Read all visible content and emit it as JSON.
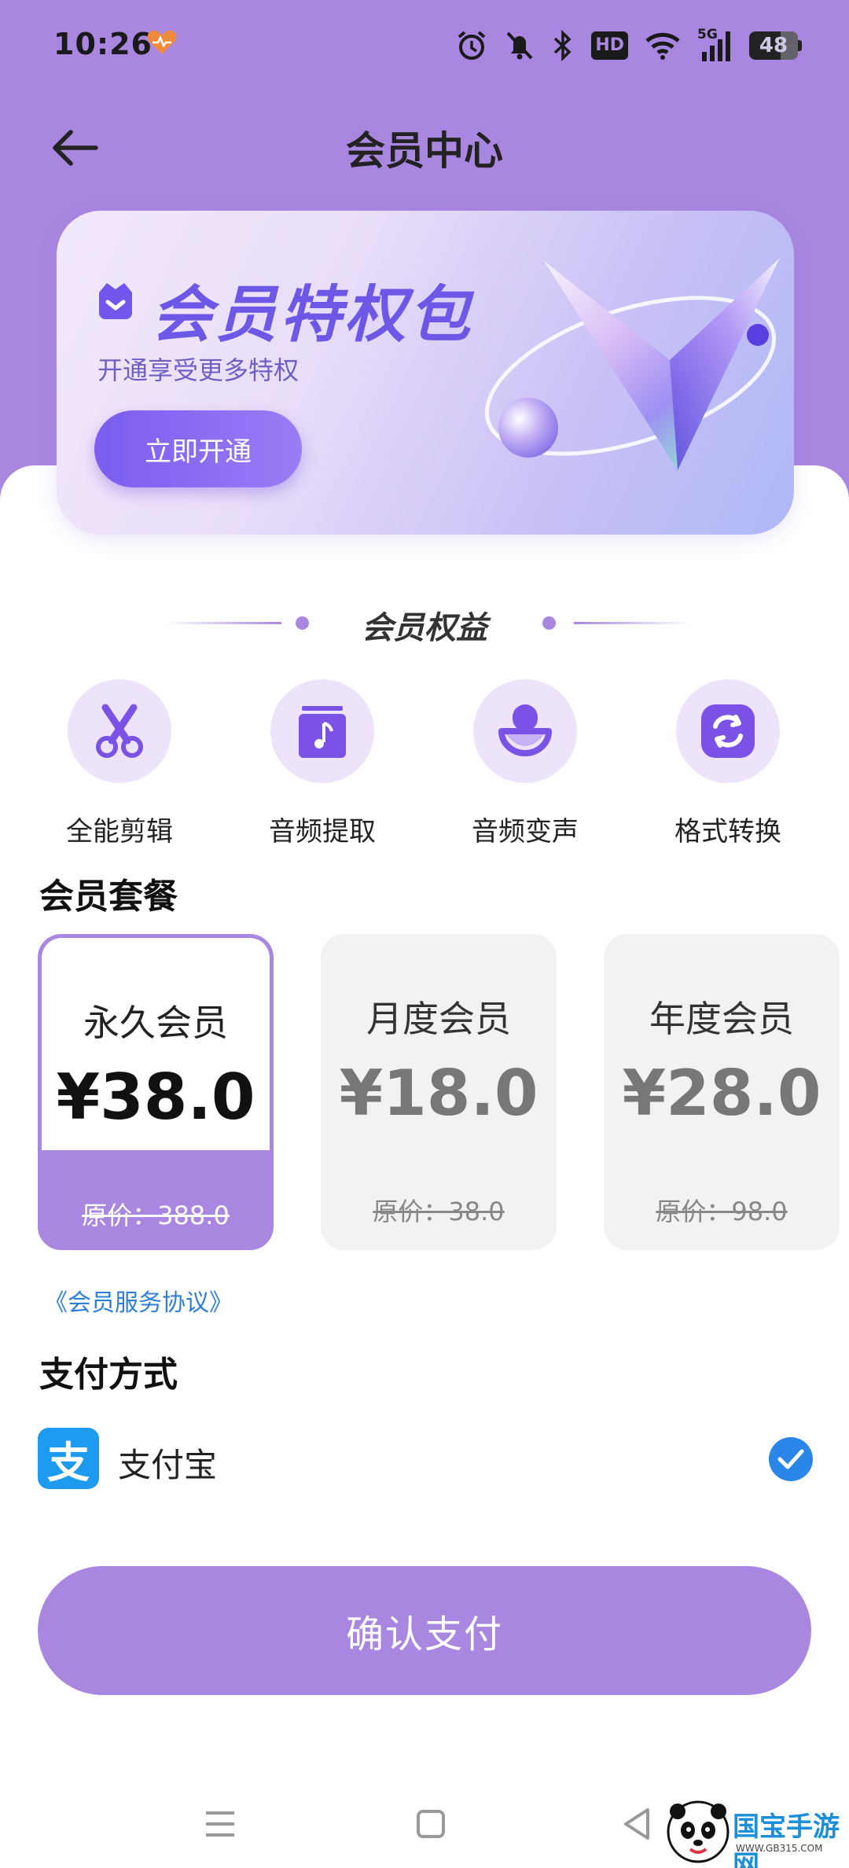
{
  "status_bar": {
    "time": "10:26",
    "network": "5G",
    "hd_label": "HD",
    "battery": "48"
  },
  "header": {
    "title": "会员中心"
  },
  "banner": {
    "title": "会员特权包",
    "subtitle": "开通享受更多特权",
    "button": "立即开通"
  },
  "benefits": {
    "title": "会员权益",
    "items": [
      {
        "label": "全能剪辑",
        "icon": "scissors-icon"
      },
      {
        "label": "音频提取",
        "icon": "music-note-icon"
      },
      {
        "label": "音频变声",
        "icon": "microphone-icon"
      },
      {
        "label": "格式转换",
        "icon": "convert-icon"
      }
    ]
  },
  "plans": {
    "title": "会员套餐",
    "items": [
      {
        "name": "永久会员",
        "price": "¥38.0",
        "original": "原价：388.0",
        "selected": true
      },
      {
        "name": "月度会员",
        "price": "¥18.0",
        "original": "原价：38.0",
        "selected": false
      },
      {
        "name": "年度会员",
        "price": "¥28.0",
        "original": "原价：98.0",
        "selected": false
      }
    ]
  },
  "agreement": "《会员服务协议》",
  "payment": {
    "title": "支付方式",
    "method": "支付宝",
    "logo_char": "支"
  },
  "confirm_button": "确认支付",
  "watermark": {
    "text": "国宝手游网",
    "url": "WWW.GB315.COM"
  },
  "colors": {
    "accent": "#a987e0",
    "alipay": "#1d9bf0",
    "check": "#2a86e8",
    "link": "#2f7fd6"
  }
}
